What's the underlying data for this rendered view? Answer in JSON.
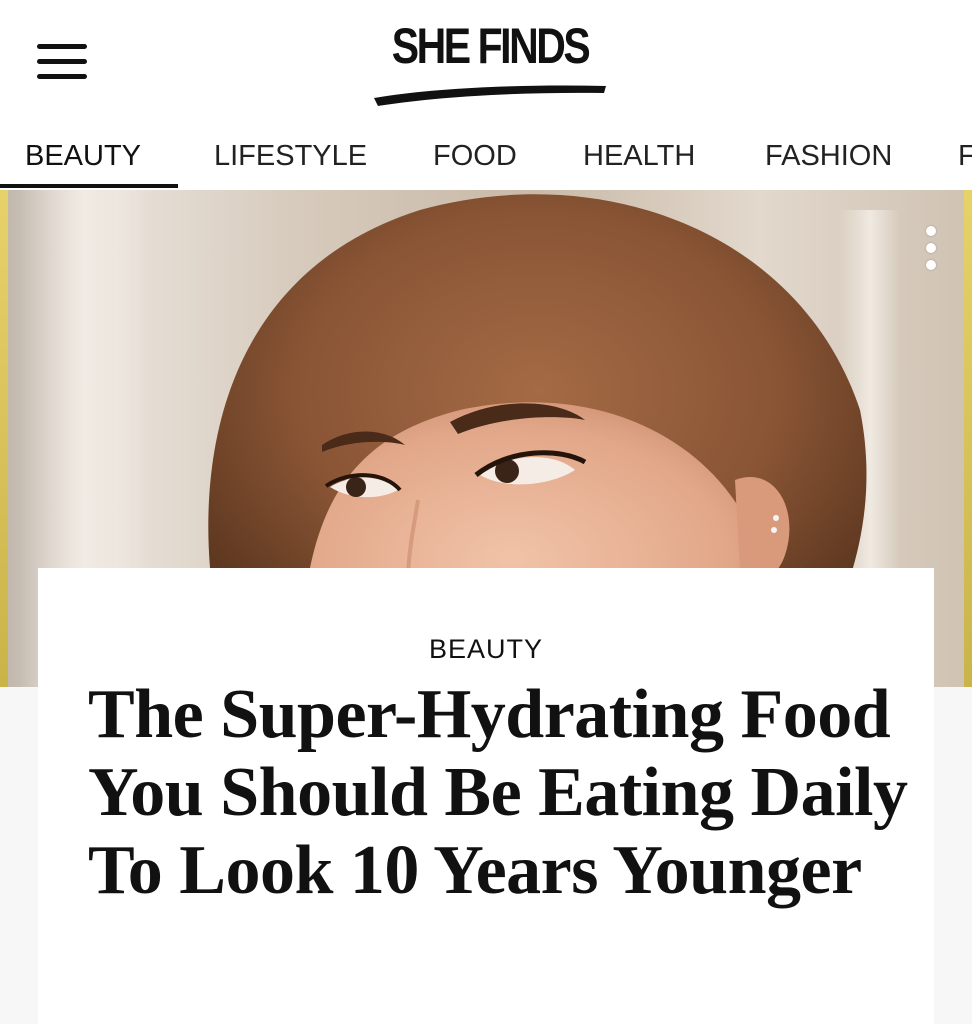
{
  "header": {
    "menu_icon": "hamburger-menu-icon",
    "logo_text": "SHE FINDS",
    "logo_swoosh_color": "#111111"
  },
  "nav": {
    "items": [
      {
        "label": "BEAUTY",
        "active": true
      },
      {
        "label": "LIFESTYLE",
        "active": false
      },
      {
        "label": "FOOD",
        "active": false
      },
      {
        "label": "HEALTH",
        "active": false
      },
      {
        "label": "FASHION",
        "active": false
      },
      {
        "label": "F",
        "active": false
      }
    ]
  },
  "hero": {
    "more_icon": "more-vertical-icon",
    "accent_color": "#e7d26a"
  },
  "article": {
    "category": "BEAUTY",
    "title": "The Super-Hydrating Food You Should Be Eating Daily To Look 10 Years Younger"
  }
}
